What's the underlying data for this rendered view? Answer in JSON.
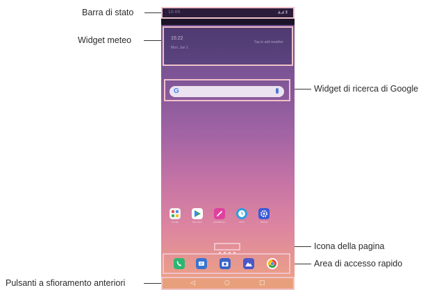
{
  "labels": {
    "status_bar": "Barra di stato",
    "weather_widget": "Widget meteo",
    "google_search_widget": "Widget di ricerca di Google",
    "page_icon": "Icona della pagina",
    "quick_access_area": "Area di accesso rapido",
    "front_touch_buttons": "Pulsanti a sfioramento anteriori"
  },
  "phone": {
    "status_left": "10:00",
    "status_right": "▲◢ ▮",
    "weather_time": "15:22",
    "weather_date": "Mon, Jan 1",
    "weather_hint": "Tap to add weather",
    "search_logo": "G",
    "apps": [
      "Google",
      "Play Store",
      "QuickMemo+",
      "Clock",
      "Settings"
    ],
    "nav_back": "◁",
    "nav_home": "○",
    "nav_recent": "□"
  },
  "colors": {
    "callout_box": "#f2c2ca",
    "leader_line": "#333333",
    "app_google": "#f2f2f2",
    "app_play": "#ffffff",
    "app_memo": "#e040a0",
    "app_clock": "#2a9fe0",
    "app_settings": "#3a5ad8",
    "dock_phone": "#2cb673",
    "dock_messages": "#3a74d0",
    "dock_camera": "#3a64c8",
    "dock_gallery": "#4a58c8",
    "dock_chrome": "#ffffff"
  }
}
